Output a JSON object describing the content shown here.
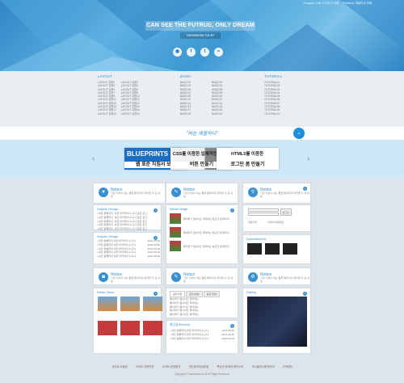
{
  "topnav": [
    "Designer Cafe 디자이너 카페",
    "Publisher 퍼블리셔 카페"
  ],
  "hero": {
    "title": "CAN SEE THE FUTRUE, ONLY DREAM",
    "subtitle": "Sumannim.Co.Kr"
  },
  "social": [
    "github-icon",
    "facebook-icon",
    "twitter-icon",
    "rss-icon"
  ],
  "menu": {
    "layout": {
      "title": "LAYOUT",
      "a": [
        "LAYOUT 유형1",
        "LAYOUT 유형3",
        "LAYOUT 유형5",
        "LAYOUT 유형7",
        "LAYOUT 유형9",
        "LAYOUT 유형11",
        "LAYOUT 유형13",
        "LAYOUT 유형15",
        "LAYOUT 유형17",
        "LAYOUT 유형19"
      ],
      "b": [
        "LAYOUT 유형2",
        "LAYOUT 유형4",
        "LAYOUT 유형6",
        "LAYOUT 유형8",
        "LAYOUT 유형10",
        "LAYOUT 유형12",
        "LAYOUT 유형14",
        "LAYOUT 유형16",
        "LAYOUT 유형18",
        "LAYOUT 유형20"
      ]
    },
    "basic": {
      "title": "BASIC",
      "a": [
        "BASIC01",
        "BASIC03",
        "BASIC05",
        "BASIC07",
        "BASIC09",
        "BASIC11",
        "BASIC13",
        "BASIC15",
        "BASIC17",
        "BASIC19"
      ],
      "b": [
        "BASIC02",
        "BASIC04",
        "BASIC06",
        "BASIC08",
        "BASIC10",
        "BASIC12",
        "BASIC14",
        "BASIC16",
        "BASIC18",
        "BASIC20"
      ]
    },
    "tutorial": {
      "title": "TUTORIAL",
      "a": [
        "TUTORIAL01",
        "TUTORIAL02",
        "TUTORIAL03",
        "TUTORIAL04",
        "TUTORIAL05",
        "TUTORIAL06",
        "TUTORIAL07",
        "TUTORIAL08",
        "TUTORIAL09",
        "TUTORIAL10"
      ]
    }
  },
  "quote": "\"버는 헤볼하다\"",
  "banners": [
    {
      "top": "BLUEPRINTS",
      "label": "웹 표준 지침서 보기"
    },
    {
      "top": "CSS를 이용한 입체적인",
      "label": "버튼 만들기"
    },
    {
      "top": "HTML5를 이용한",
      "label": "로그인 폼 만들기"
    }
  ],
  "widgets": [
    {
      "icon": "heart-icon",
      "title": "Notice",
      "text": "가장 기본이 되는 웹을 웹퍼지의 제작을 두 걸 내용"
    },
    {
      "icon": "pencil-icon",
      "title": "Notice",
      "text": "가장 기본이 되는 웹을 웹퍼지의 제작을 두 걸 내용"
    },
    {
      "icon": "search-icon",
      "title": "Notice",
      "text": "가장 기본이 되는 웹을 웹퍼지의 제작을 두 걸 내용"
    },
    {
      "icon": "camera-icon",
      "title": "Notice",
      "text": "가장 기본이 되는 웹을 웹퍼지의 제작을 두 걸 내용"
    },
    {
      "icon": "pencil-icon",
      "title": "Notice",
      "text": "가장 기본이 되는 웹을 웹퍼지의 제작을 두 걸 내용"
    },
    {
      "icon": "gear-icon",
      "title": "Notice",
      "text": "가장 기본이 되는 웹을 웹퍼지의 제작을 두 걸 내용"
    }
  ],
  "graphic1": {
    "title": "Graphic Design",
    "items": [
      "• 외전 분별하지, 외전 파커파이 누구나 잡은 참고",
      "• 외전 분별하지, 외전 파커파이 누구나 잡은 참고",
      "• 외전 분별하지, 외전 파커파이 누구나 잡은 참고",
      "• 외전 분별하지, 외전 파커파이 누구나 잡은 참고",
      "• 외전 분별하지, 외전 파커파이 누구나 잡은 참고"
    ]
  },
  "graphic2": {
    "title": "Graphic Design",
    "items": [
      [
        "• 외전 분별하지 외전 파커파이 누구나",
        "2022.05.28"
      ],
      [
        "• 외전 분별하지 외전 파커파이 누구나",
        "2022.05.28"
      ],
      [
        "• 외전 분별하지 외전 파커파이 누구나",
        "2022.05.28"
      ],
      [
        "• 외전 분별하지 외전 파커파이 누구나",
        "2022.05.28"
      ],
      [
        "• 외전 분별하지 외전 파커파이 누구나",
        "2022.05.28"
      ]
    ]
  },
  "notice_image": {
    "title": "Notice Image",
    "items": [
      "웨이퍼가 웹사이트 제작하는 필요한 웹 페이지",
      "웨이퍼가 웹사이트 제작하는 필요한 웹 페이지",
      "웨이퍼가 웹사이트 제작하는 필요한 웹 페이지"
    ]
  },
  "login": {
    "login_btn": "로그인",
    "join": "회원가입",
    "find": "아이디/비밀번호"
  },
  "advertisement": {
    "title": "Advertisement"
  },
  "notice_news": {
    "title": "Notice News"
  },
  "tabs": [
    "공지사항",
    "공지사항2",
    "공지사항3"
  ],
  "tab_items": [
    "웨이퍼가 웹사이트 제작하는",
    "웨이퍼가 웹사이트 제작하는",
    "웨이퍼가 웹사이트 제작하는",
    "웨이퍼가 웹사이트 제작하는",
    "웨이퍼가 웹사이트 제작하는"
  ],
  "recent": {
    "title": "최신글(Recent)",
    "items": [
      [
        "• 외전 분별하지 외전 파커파이 누구나",
        "2022.08.28"
      ],
      [
        "• 외전 분별하지 외전 파커파이 누구나",
        "2022.08.28"
      ],
      [
        "• 외전 분별하지 외전 파커파이 누구나",
        "2022.08.28"
      ]
    ]
  },
  "gallery": {
    "title": "Gallery"
  },
  "footer": [
    "사이트 도움말",
    "사이트 이용약관",
    "사이트 운영원칙",
    "개인정보취급방침",
    "책임의 한계와 법적고지",
    "게시물게시원칙안내",
    "고객센터"
  ],
  "copyright": "Copyright © sumannim.co.kr All Right Reserved"
}
